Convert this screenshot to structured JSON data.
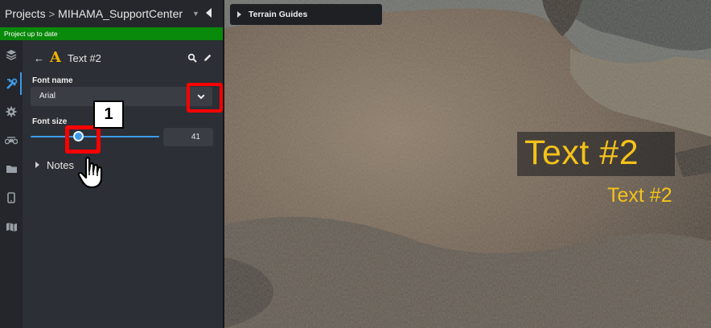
{
  "breadcrumb": {
    "root": "Projects",
    "separator": ">",
    "project": "MIHAMA_SupportCenter"
  },
  "status": {
    "text": "Project up to date",
    "color": "#0a8a0a"
  },
  "rail": {
    "icons": [
      "layers-icon",
      "tools-icon",
      "settings-icon",
      "drone-icon",
      "folder-icon",
      "mobile-icon",
      "map-icon"
    ],
    "active": "tools-icon"
  },
  "panel": {
    "title": "Text #2",
    "title_icon": "text-icon",
    "font": {
      "label": "Font name",
      "value": "Arial"
    },
    "size": {
      "label": "Font size",
      "value": "41",
      "slider_fraction": 0.37
    },
    "notes_label": "Notes"
  },
  "annotations": {
    "step_number": "1",
    "highlight_color": "#ff0000"
  },
  "viewport": {
    "terrain_guides_label": "Terrain Guides",
    "label_large": "Text #2",
    "label_small": "Text #2",
    "label_color": "#f4c21a"
  },
  "accent": "#3d9be9"
}
